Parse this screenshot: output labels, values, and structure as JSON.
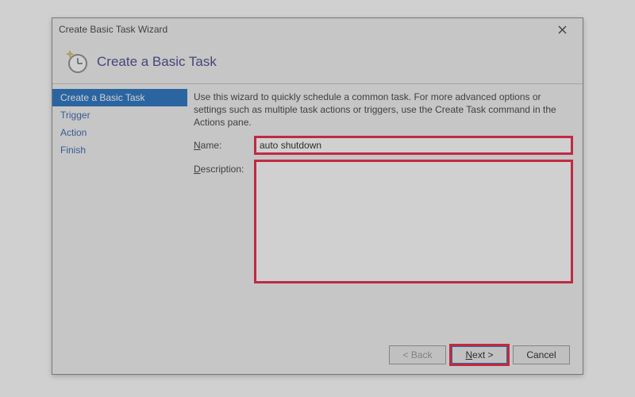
{
  "window": {
    "title": "Create Basic Task Wizard"
  },
  "header": {
    "title": "Create a Basic Task"
  },
  "steps": [
    {
      "label": "Create a Basic Task",
      "active": true
    },
    {
      "label": "Trigger",
      "active": false
    },
    {
      "label": "Action",
      "active": false
    },
    {
      "label": "Finish",
      "active": false
    }
  ],
  "content": {
    "intro": "Use this wizard to quickly schedule a common task.  For more advanced options or settings such as multiple task actions or triggers, use the Create Task command in the Actions pane.",
    "name_label_prefix": "N",
    "name_label_rest": "ame:",
    "name_value": "auto shutdown",
    "description_label_prefix": "D",
    "description_label_rest": "escription:",
    "description_value": ""
  },
  "footer": {
    "back_label": "< Back",
    "next_label_prefix": "N",
    "next_label_rest": "ext >",
    "cancel_label": "Cancel"
  },
  "colors": {
    "accent_highlight": "#e60026",
    "step_active_bg": "#005bb7",
    "header_text": "#2a2a7a"
  }
}
